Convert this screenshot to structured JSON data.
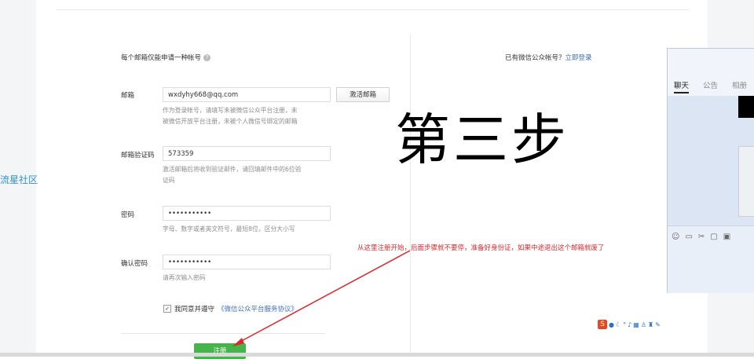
{
  "form": {
    "notice": "每个邮箱仅能申请一种帐号",
    "have_account_text": "已有微信公众帐号？",
    "login_link": "立即登录",
    "email_label": "邮箱",
    "email_value": "wxdyhy668@qq.com",
    "email_hint": [
      "作为登录帐号，请填写未被微信公众平台注册，未",
      "被微信开放平台注册，未被个人微信号绑定的邮箱"
    ],
    "activate_button": "激活邮箱",
    "code_label": "邮箱验证码",
    "code_value": "573359",
    "code_hint": [
      "激活邮箱后将收到验证邮件，请回填邮件中的6位验",
      "证码"
    ],
    "password_label": "密码",
    "password_value": "•••••••••••",
    "password_hint": "字母、数字或者英文符号，最短8位，区分大小写",
    "confirm_label": "确认密码",
    "confirm_value": "•••••••••••",
    "confirm_hint": "请再次输入密码",
    "agree_text": "我同意并遵守",
    "agreement_link": "《微信公众平台服务协议》",
    "register_button": "注册"
  },
  "overlay": {
    "big_title": "第三步",
    "annotation": "从这里注册开始，后面步骤就不要停，准备好身份证，如果中途退出这个邮箱就废了",
    "left_watermark": "流星社区"
  },
  "chat_panel": {
    "tabs": [
      "聊天",
      "公告",
      "相册"
    ]
  },
  "ime": {
    "logo": "S"
  },
  "colors": {
    "accent_green": "#44b549",
    "link_blue": "#3e6dbb",
    "annotation_red": "#e0262b"
  }
}
